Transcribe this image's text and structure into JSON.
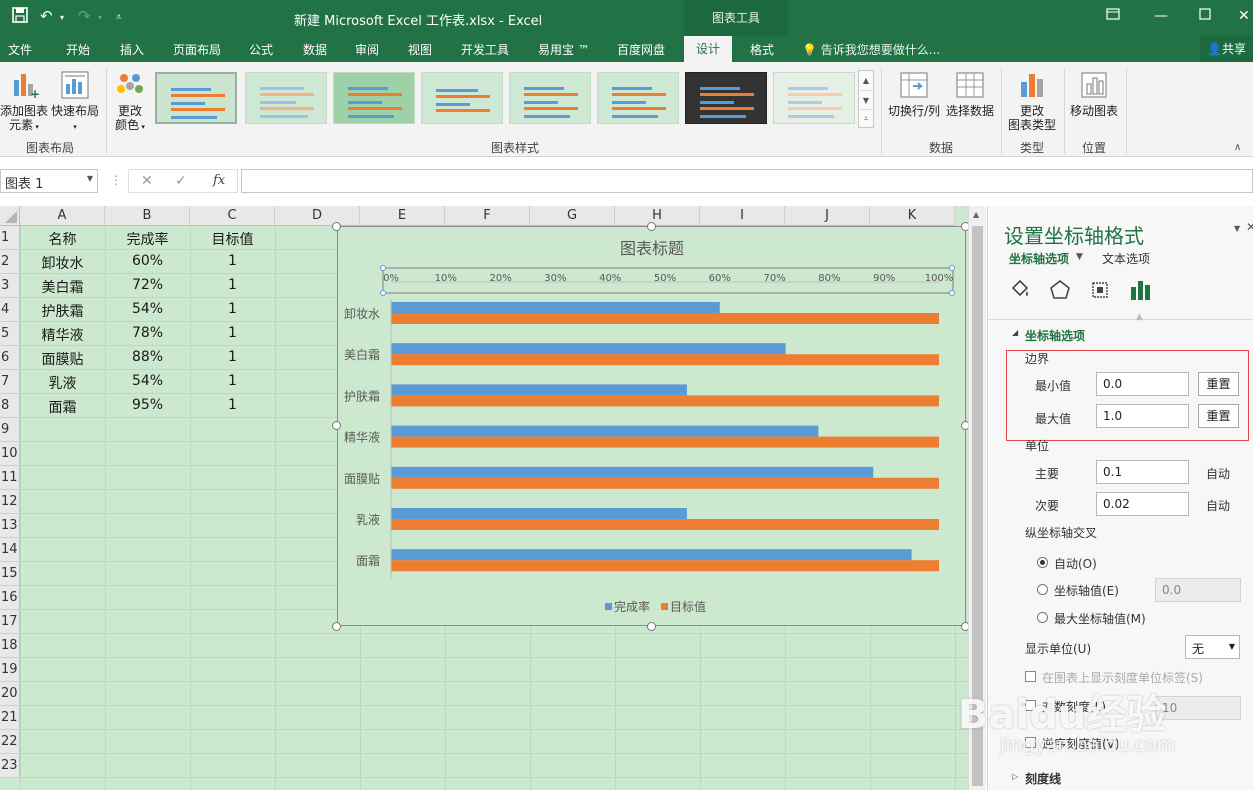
{
  "window": {
    "title": "新建 Microsoft Excel 工作表.xlsx - Excel",
    "contextual_group": "图表工具"
  },
  "tabs": [
    "文件",
    "开始",
    "插入",
    "页面布局",
    "公式",
    "数据",
    "审阅",
    "视图",
    "开发工具",
    "易用宝 ™",
    "百度网盘",
    "设计",
    "格式"
  ],
  "active_tab": "设计",
  "tell_me": "告诉我您想要做什么...",
  "share": "共享",
  "ribbon": {
    "add_element_line1": "添加图表",
    "add_element_line2": "元素",
    "quick_layout": "快速布局",
    "change_colors_line1": "更改",
    "change_colors_line2": "颜色",
    "group_layout": "图表布局",
    "group_styles": "图表样式",
    "switch_rowcol": "切换行/列",
    "select_data": "选择数据",
    "group_data": "数据",
    "change_type_line1": "更改",
    "change_type_line2": "图表类型",
    "group_type": "类型",
    "move_chart": "移动图表",
    "group_location": "位置"
  },
  "formula_bar": {
    "name_box": "图表 1",
    "cancel": "✕",
    "enter": "✓",
    "fx": "fx",
    "formula": ""
  },
  "grid": {
    "columns": [
      "A",
      "B",
      "C",
      "D",
      "E",
      "F",
      "G",
      "H",
      "I",
      "J",
      "K"
    ],
    "rows": [
      "1",
      "2",
      "3",
      "4",
      "5",
      "6",
      "7",
      "8",
      "9",
      "10",
      "11",
      "12",
      "13",
      "14",
      "15",
      "16",
      "17",
      "18",
      "19",
      "20",
      "21",
      "22",
      "23"
    ],
    "header": [
      "名称",
      "完成率",
      "目标值"
    ],
    "data": [
      [
        "卸妆水",
        "60%",
        "1"
      ],
      [
        "美白霜",
        "72%",
        "1"
      ],
      [
        "护肤霜",
        "54%",
        "1"
      ],
      [
        "精华液",
        "78%",
        "1"
      ],
      [
        "面膜贴",
        "88%",
        "1"
      ],
      [
        "乳液",
        "54%",
        "1"
      ],
      [
        "面霜",
        "95%",
        "1"
      ]
    ]
  },
  "chart_data": {
    "type": "bar",
    "orientation": "horizontal",
    "title": "图表标题",
    "categories": [
      "卸妆水",
      "美白霜",
      "护肤霜",
      "精华液",
      "面膜贴",
      "乳液",
      "面霜"
    ],
    "series": [
      {
        "name": "完成率",
        "color": "#5b9bd5",
        "values": [
          0.6,
          0.72,
          0.54,
          0.78,
          0.88,
          0.54,
          0.95
        ]
      },
      {
        "name": "目标值",
        "color": "#ed7d31",
        "values": [
          1,
          1,
          1,
          1,
          1,
          1,
          1
        ]
      }
    ],
    "x_ticks": [
      "0%",
      "10%",
      "20%",
      "30%",
      "40%",
      "50%",
      "60%",
      "70%",
      "80%",
      "90%",
      "100%"
    ],
    "xlim": [
      0,
      1
    ],
    "x_axis_position": "top",
    "legend_position": "bottom",
    "grid": false
  },
  "pane": {
    "title": "设置坐标轴格式",
    "tab_axis": "坐标轴选项",
    "tab_text": "文本选项",
    "section_axis": "坐标轴选项",
    "bounds": "边界",
    "min_label": "最小值",
    "min_value": "0.0",
    "max_label": "最大值",
    "max_value": "1.0",
    "reset": "重置",
    "units": "单位",
    "major_label": "主要",
    "major_value": "0.1",
    "minor_label": "次要",
    "minor_value": "0.02",
    "auto": "自动",
    "cross_title": "纵坐标轴交叉",
    "cross_auto": "自动(O)",
    "cross_value": "坐标轴值(E)",
    "cross_value_input": "0.0",
    "cross_max": "最大坐标轴值(M)",
    "display_units": "显示单位(U)",
    "display_units_value": "无",
    "show_units_label": "在图表上显示刻度单位标签(S)",
    "log_scale": "对数刻度(L)",
    "base_value": "10",
    "reverse": "逆序刻度值(V)",
    "tick_marks": "刻度线"
  },
  "watermark": {
    "brand": "Baidu经验",
    "url": "jingyan.baidu.com"
  }
}
